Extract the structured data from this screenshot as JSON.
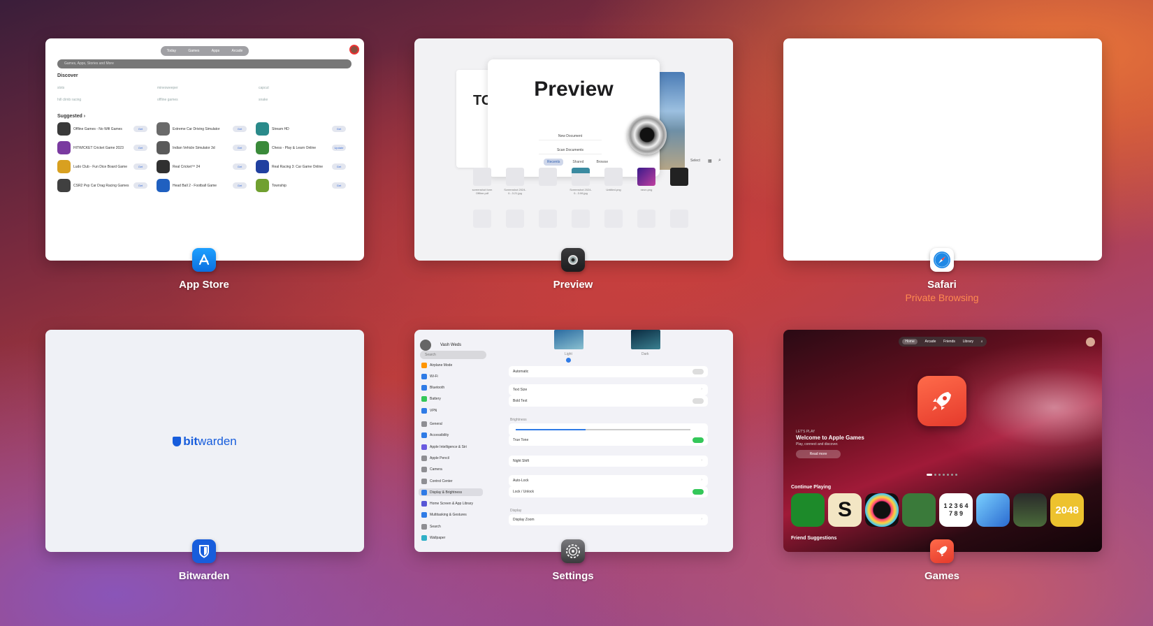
{
  "apps": [
    {
      "name": "App Store"
    },
    {
      "name": "Preview"
    },
    {
      "name": "Safari",
      "subtitle": "Private Browsing"
    },
    {
      "name": "Bitwarden"
    },
    {
      "name": "Settings"
    },
    {
      "name": "Games"
    }
  ],
  "appstore": {
    "tabs": [
      "Today",
      "Games",
      "Apps",
      "Arcade"
    ],
    "search_placeholder": "Games, Apps, Stories and More",
    "discover_heading": "Discover",
    "discover_chips": [
      "slots",
      "minesweeper",
      "capcut",
      "hill climb racing",
      "offline games",
      "snake"
    ],
    "suggested_heading": "Suggested ›",
    "rows": [
      {
        "name": "Offline Games - No Wifi Games",
        "btn": "Get",
        "color": "#3a3a3a"
      },
      {
        "name": "Extreme Car Driving Simulator",
        "btn": "Get",
        "color": "#6a6a6a"
      },
      {
        "name": "Stream HD",
        "btn": "Get",
        "color": "#2a8a8a"
      },
      {
        "name": "HITWICKET Cricket Game 2023",
        "btn": "Get",
        "color": "#7a3aa0"
      },
      {
        "name": "Indian Vehicle Simulator 3d",
        "btn": "Get",
        "color": "#5a5a5a"
      },
      {
        "name": "Chess - Play & Learn Online",
        "btn": "Update",
        "color": "#3a8a3a"
      },
      {
        "name": "Ludo Club - Fun Dice Board Game",
        "btn": "Get",
        "color": "#d8a020"
      },
      {
        "name": "Real Cricket™ 24",
        "btn": "Get",
        "color": "#303030"
      },
      {
        "name": "Real Racing 3: Car Game Online",
        "btn": "Get",
        "color": "#2040a0"
      },
      {
        "name": "CSR2 Pvp Car Drag Racing Games",
        "btn": "Get",
        "color": "#404040"
      },
      {
        "name": "Head Ball 2 - Football Game",
        "btn": "Get",
        "color": "#2060c0"
      },
      {
        "name": "Township",
        "btn": "Get",
        "color": "#70a030"
      }
    ]
  },
  "preview": {
    "title": "Preview",
    "back_title": "TO",
    "buttons": [
      "New Document",
      "Scan Documents"
    ],
    "tabs": [
      "Recents",
      "Shared",
      "Browse"
    ],
    "select_label": "Select",
    "files": [
      {
        "name": "screenshot form Offline.pdf"
      },
      {
        "name": "Screenshot 2024-0...3.21.jpg"
      },
      {
        "name": ""
      },
      {
        "name": "Screenshot 2024-0...3.06.jpg"
      },
      {
        "name": "Untitled.png"
      },
      {
        "name": "neon.png"
      },
      {
        "name": ""
      }
    ]
  },
  "bitwarden": {
    "logo_bold": "bit",
    "logo_rest": "warden"
  },
  "settings": {
    "user": "Vash Weds",
    "search": "Search",
    "sidebar": [
      {
        "label": "Airplane Mode",
        "color": "#ff9500"
      },
      {
        "label": "Wi-Fi",
        "color": "#2f7be6"
      },
      {
        "label": "Bluetooth",
        "color": "#2f7be6"
      },
      {
        "label": "Battery",
        "color": "#34c759"
      },
      {
        "label": "VPN",
        "color": "#2f7be6"
      },
      {
        "label": "General",
        "color": "#8e8e93"
      },
      {
        "label": "Accessibility",
        "color": "#2f7be6"
      },
      {
        "label": "Apple Intelligence & Siri",
        "color": "#6a5ae0"
      },
      {
        "label": "Apple Pencil",
        "color": "#8e8e93"
      },
      {
        "label": "Camera",
        "color": "#8e8e93"
      },
      {
        "label": "Control Center",
        "color": "#8e8e93"
      },
      {
        "label": "Display & Brightness",
        "color": "#2f7be6",
        "selected": true
      },
      {
        "label": "Home Screen & App Library",
        "color": "#5856d6"
      },
      {
        "label": "Multitasking & Gestures",
        "color": "#2f7be6"
      },
      {
        "label": "Search",
        "color": "#8e8e93"
      },
      {
        "label": "Wallpaper",
        "color": "#30b0c7"
      }
    ],
    "thumb_light": "Light",
    "thumb_dark": "Dark",
    "rows": [
      {
        "label": "Automatic",
        "toggle": "off"
      },
      {
        "label": "Text Size",
        "toggle": "none"
      },
      {
        "label": "Bold Text",
        "toggle": "off"
      },
      {
        "label": "True Tone",
        "toggle": "on"
      },
      {
        "label": "Night Shift",
        "toggle": "none"
      },
      {
        "label": "Auto-Lock",
        "toggle": "none"
      },
      {
        "label": "Lock / Unlock",
        "toggle": "on"
      },
      {
        "label": "Display Zoom",
        "toggle": "none"
      }
    ],
    "brightness_label": "Brightness",
    "brightness_level": 0.4,
    "display_label": "Display"
  },
  "games": {
    "nav": [
      "Home",
      "Arcade",
      "Friends",
      "Library"
    ],
    "kicker": "LET'S PLAY",
    "title": "Welcome to Apple Games",
    "subtitle": "Play, connect and discover.",
    "button": "Read more",
    "continue_heading": "Continue Playing",
    "friends_heading": "Friend Suggestions",
    "tiles": [
      {
        "label": "",
        "color": "#1d8a2a"
      },
      {
        "label": "S",
        "color": "#f3e6c4"
      },
      {
        "label": "",
        "color": "#111111"
      },
      {
        "label": "",
        "color": "#3a7a3a"
      },
      {
        "label": "1 2 3 6 4 7 8 9",
        "color": "#ffffff"
      },
      {
        "label": "",
        "color": "#2a6ad0"
      },
      {
        "label": "",
        "color": "#2a2a2a"
      },
      {
        "label": "2048",
        "color": "#edc22e"
      }
    ]
  }
}
